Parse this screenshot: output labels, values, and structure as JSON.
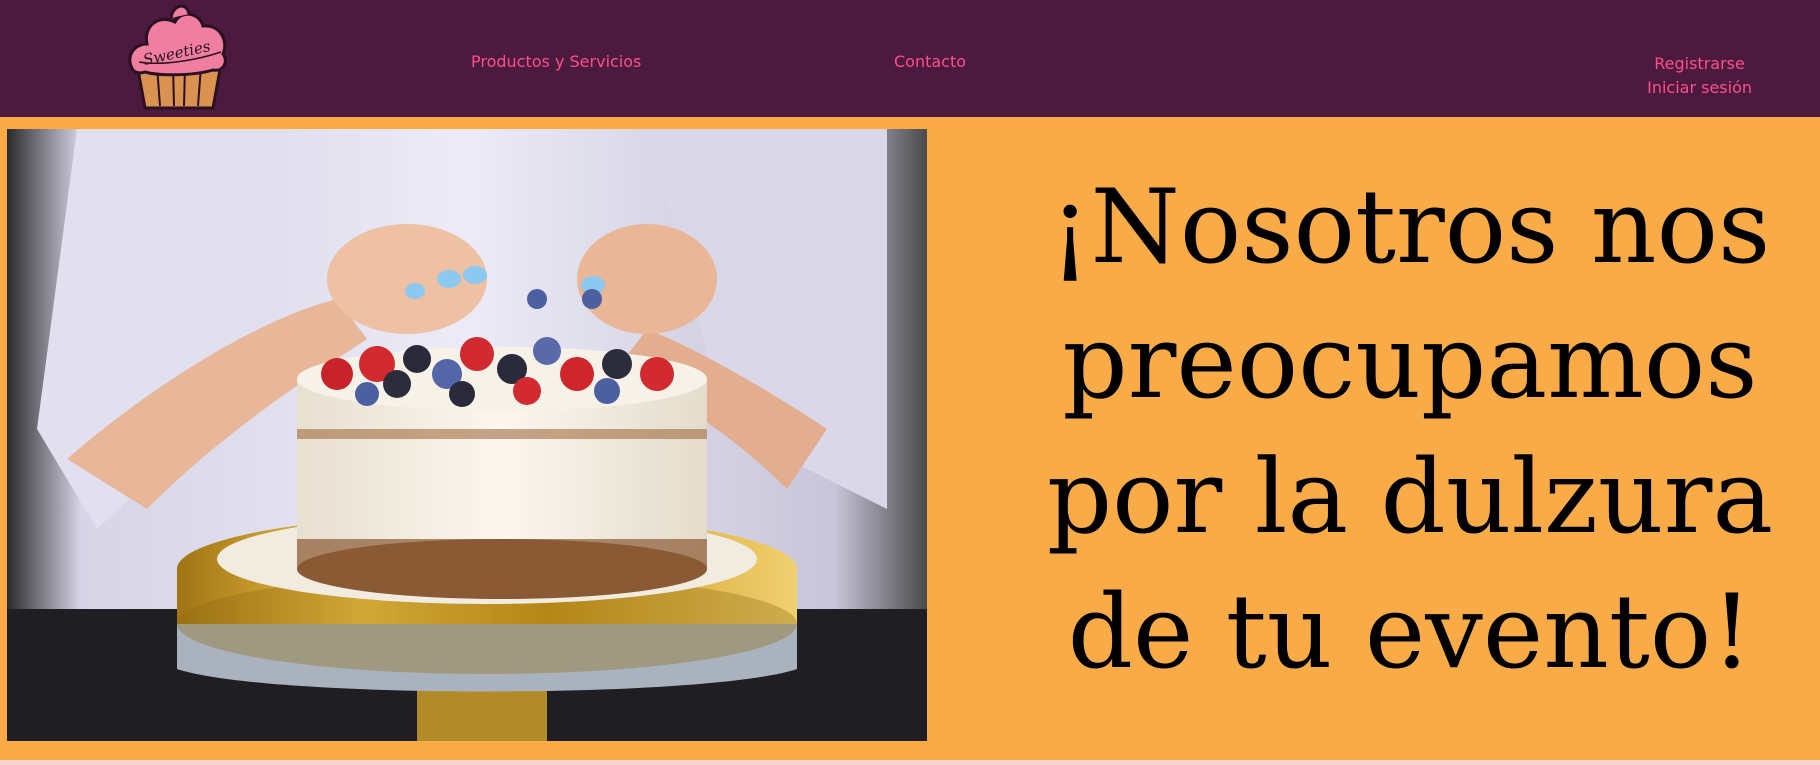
{
  "logo": {
    "text": "Sweeties",
    "icon": "cupcake-icon"
  },
  "nav": {
    "products_label": "Productos y Servicios",
    "contact_label": "Contacto",
    "register_label": "Registrarse",
    "login_label": "Iniciar sesión"
  },
  "hero": {
    "heading": "¡Nosotros nos preocupamos por la dulzura de tu evento!",
    "image_alt": "Pastel decorado con frutos rojos"
  },
  "colors": {
    "navbar": "#4b1a3e",
    "nav_link": "#ff4d8d",
    "hero_background": "#f9ab48",
    "heading": "#000000"
  }
}
